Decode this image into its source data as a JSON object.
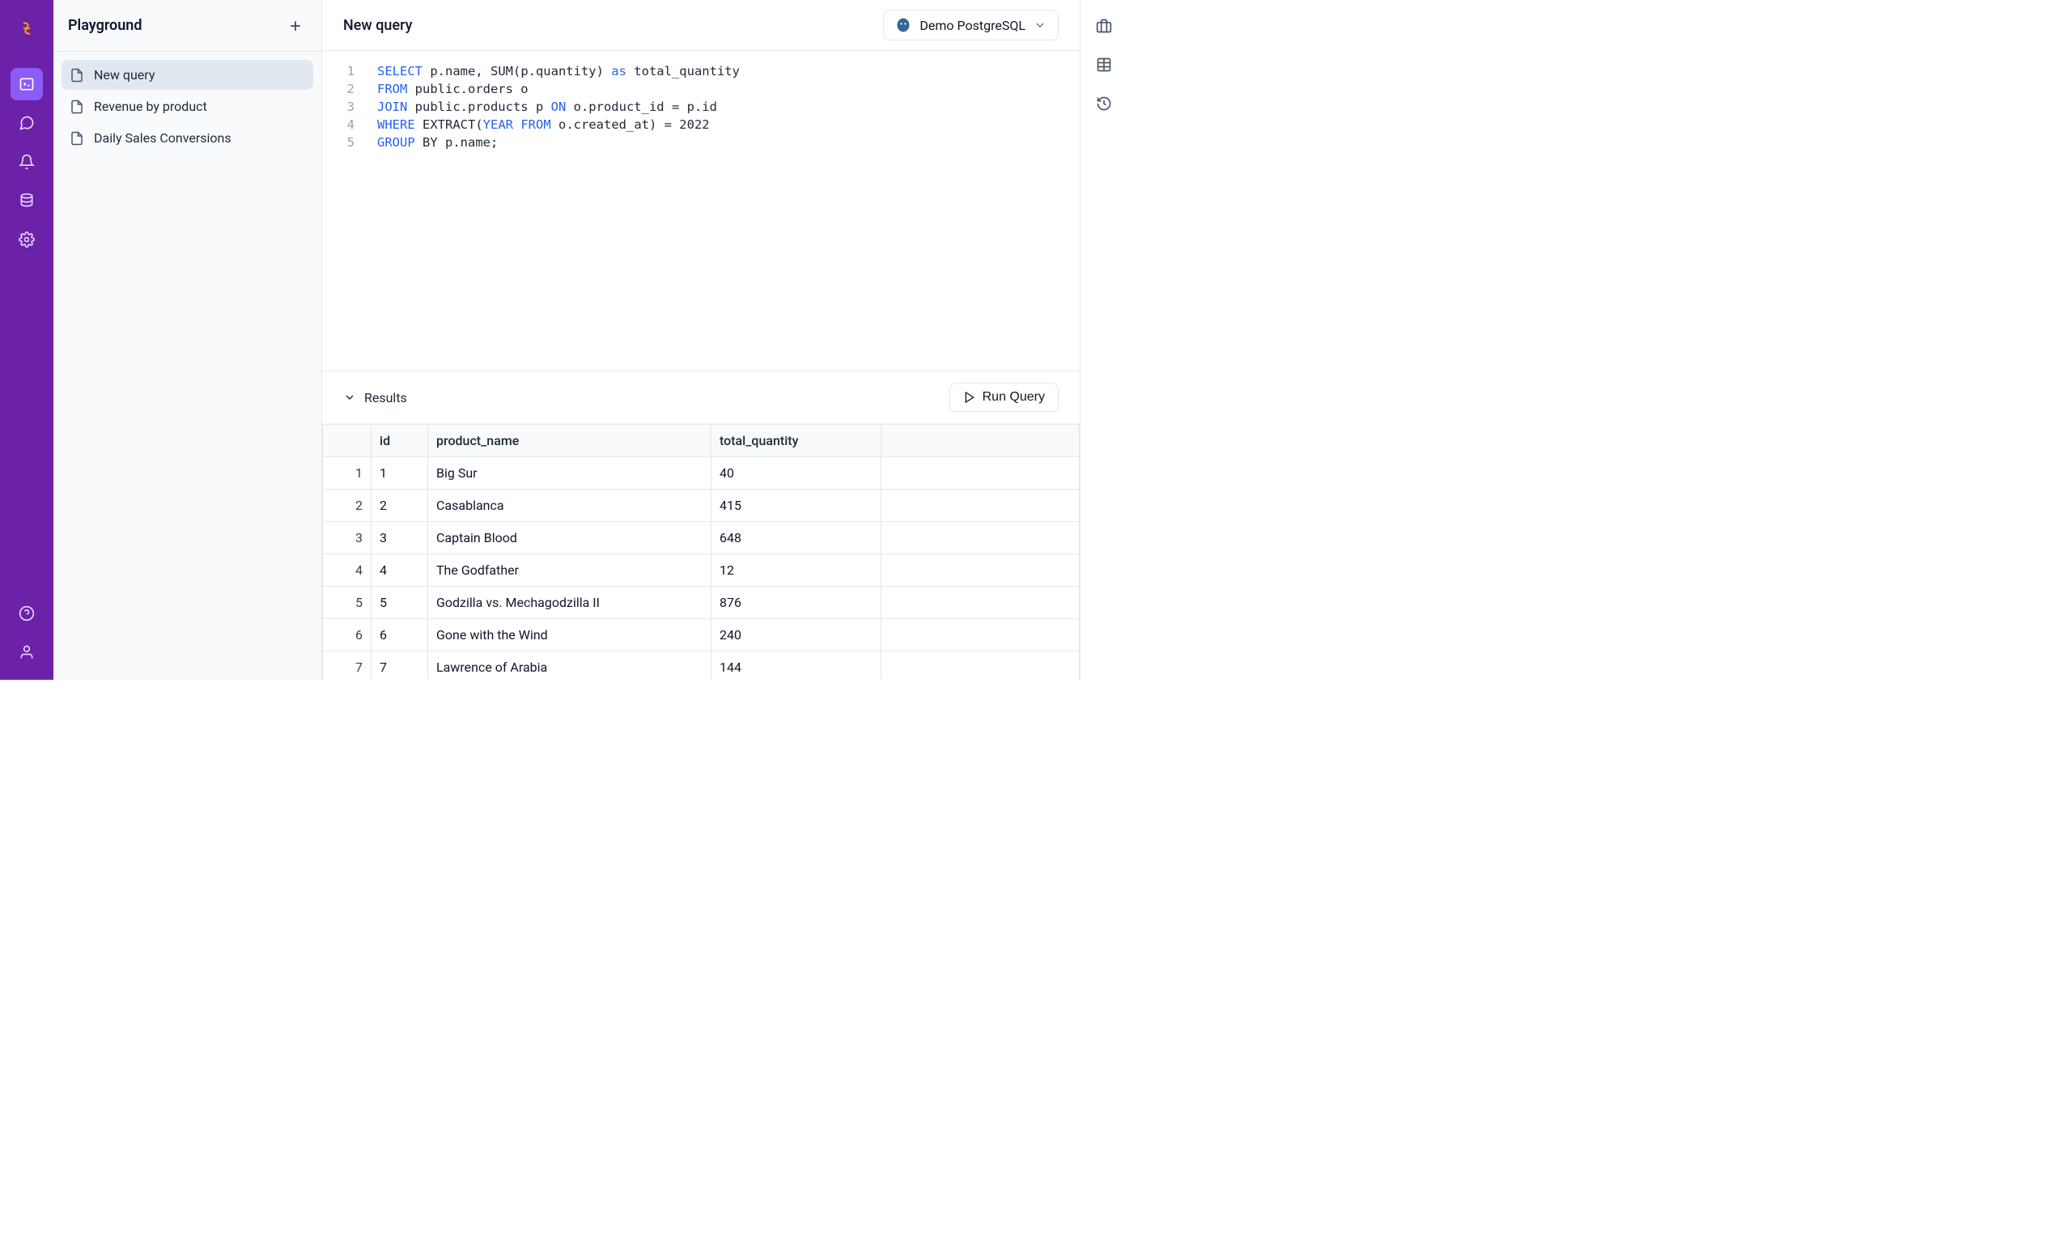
{
  "sidebar": {
    "title": "Playground",
    "items": [
      {
        "label": "New query",
        "active": true
      },
      {
        "label": "Revenue by product",
        "active": false
      },
      {
        "label": "Daily Sales Conversions",
        "active": false
      }
    ]
  },
  "main": {
    "title": "New query",
    "database_selector": "Demo PostgreSQL",
    "run_button": "Run Query",
    "results_label": "Results"
  },
  "sql": {
    "lines": [
      [
        [
          "SELECT",
          "kw"
        ],
        [
          " p.name, SUM(p.quantity) ",
          ""
        ],
        [
          "as",
          "kw"
        ],
        [
          " total_quantity",
          ""
        ]
      ],
      [
        [
          "FROM",
          "kw"
        ],
        [
          " public.orders o",
          ""
        ]
      ],
      [
        [
          "JOIN",
          "kw"
        ],
        [
          " public.products p ",
          ""
        ],
        [
          "ON",
          "kw"
        ],
        [
          " o.product_id = p.id",
          ""
        ]
      ],
      [
        [
          "WHERE",
          "kw"
        ],
        [
          " EXTRACT(",
          ""
        ],
        [
          "YEAR FROM",
          "kw"
        ],
        [
          " o.created_at) = 2022",
          ""
        ]
      ],
      [
        [
          "GROUP",
          "kw"
        ],
        [
          " BY p.name;",
          ""
        ]
      ]
    ]
  },
  "results": {
    "columns": [
      "id",
      "product_name",
      "total_quantity"
    ],
    "rows": [
      {
        "n": 1,
        "id": "1",
        "product_name": "Big Sur",
        "total_quantity": "40"
      },
      {
        "n": 2,
        "id": "2",
        "product_name": "Casablanca",
        "total_quantity": "415"
      },
      {
        "n": 3,
        "id": "3",
        "product_name": "Captain Blood",
        "total_quantity": "648"
      },
      {
        "n": 4,
        "id": "4",
        "product_name": "The Godfather",
        "total_quantity": "12"
      },
      {
        "n": 5,
        "id": "5",
        "product_name": "Godzilla vs. Mechagodzilla II",
        "total_quantity": "876"
      },
      {
        "n": 6,
        "id": "6",
        "product_name": "Gone with the Wind",
        "total_quantity": "240"
      },
      {
        "n": 7,
        "id": "7",
        "product_name": "Lawrence of Arabia",
        "total_quantity": "144"
      }
    ]
  }
}
